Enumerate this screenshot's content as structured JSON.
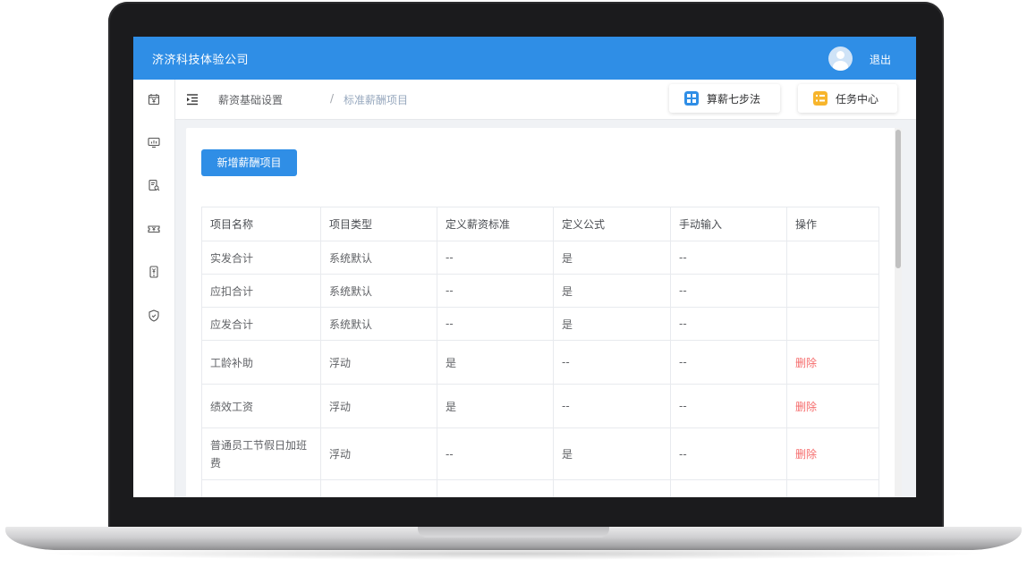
{
  "header": {
    "company": "济济科技体验公司",
    "logout_label": "退出",
    "accent_color": "#2f8ee6"
  },
  "sidebar": {
    "icons": [
      "calendar-yen-icon",
      "monitor-chart-icon",
      "document-search-icon",
      "ticket-yen-icon",
      "phone-yen-icon",
      "shield-icon"
    ]
  },
  "navbar": {
    "breadcrumb": [
      "薪资基础设置",
      "标准薪酬项目"
    ],
    "separator": "/",
    "calc_button_label": "算薪七步法",
    "task_button_label": "任务中心"
  },
  "main": {
    "add_button_label": "新增薪酬项目",
    "table": {
      "columns": [
        "项目名称",
        "项目类型",
        "定义薪资标准",
        "定义公式",
        "手动输入",
        "操作"
      ],
      "rows": [
        [
          "实发合计",
          "系统默认",
          "--",
          "是",
          "--",
          ""
        ],
        [
          "应扣合计",
          "系统默认",
          "--",
          "是",
          "--",
          ""
        ],
        [
          "应发合计",
          "系统默认",
          "--",
          "是",
          "--",
          ""
        ],
        [
          "工龄补助",
          "浮动",
          "是",
          "--",
          "--",
          "删除"
        ],
        [
          "绩效工资",
          "浮动",
          "是",
          "--",
          "--",
          "删除"
        ],
        [
          "普通员工节假日加班费",
          "浮动",
          "--",
          "是",
          "--",
          "删除"
        ]
      ]
    }
  }
}
